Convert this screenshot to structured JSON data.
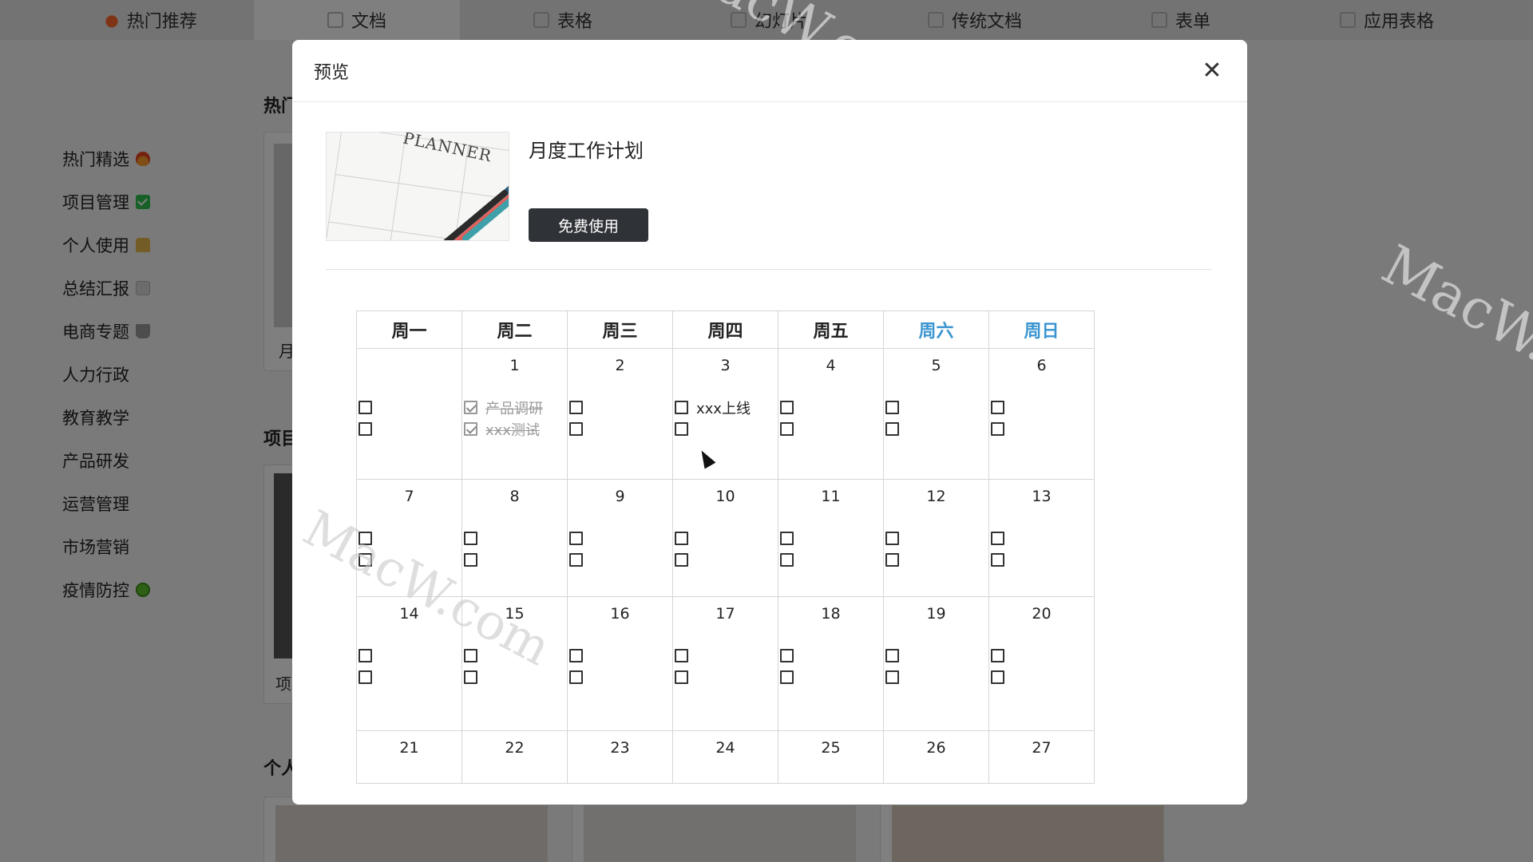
{
  "top_tabs": [
    {
      "label": "热门推荐",
      "icon": "fire-icon"
    },
    {
      "label": "文档",
      "icon": "doc-icon"
    },
    {
      "label": "表格",
      "icon": "sheet-icon"
    },
    {
      "label": "幻灯片",
      "icon": "slide-icon"
    },
    {
      "label": "传统文档",
      "icon": "word-icon"
    },
    {
      "label": "表单",
      "icon": "form-icon"
    },
    {
      "label": "应用表格",
      "icon": "app-sheet-icon"
    }
  ],
  "sidebar": {
    "items": [
      {
        "label": "热门精选",
        "icon": "fire-emoji"
      },
      {
        "label": "项目管理",
        "icon": "check-emoji"
      },
      {
        "label": "个人使用",
        "icon": "person-emoji"
      },
      {
        "label": "总结汇报",
        "icon": "doc-emoji"
      },
      {
        "label": "电商专题",
        "icon": "cart-emoji"
      },
      {
        "label": "人力行政",
        "icon": ""
      },
      {
        "label": "教育教学",
        "icon": ""
      },
      {
        "label": "产品研发",
        "icon": ""
      },
      {
        "label": "运营管理",
        "icon": ""
      },
      {
        "label": "市场营销",
        "icon": ""
      },
      {
        "label": "疫情防控",
        "icon": "virus-emoji"
      }
    ]
  },
  "background": {
    "heading_1": "热门",
    "heading_2": "项目",
    "heading_3": "个人",
    "card_1_label": "月",
    "card_2_label": "项"
  },
  "modal": {
    "title": "预览",
    "close_icon": "close-icon",
    "template_name": "月度工作计划",
    "thumbnail_text": "PLANNER",
    "use_button": "免费使用"
  },
  "calendar": {
    "weekdays": [
      "周一",
      "周二",
      "周三",
      "周四",
      "周五",
      "周六",
      "周日"
    ],
    "weekend_color": "#3a95d0",
    "weeks": [
      [
        "",
        "1",
        "2",
        "3",
        "4",
        "5",
        "6"
      ],
      [
        "7",
        "8",
        "9",
        "10",
        "11",
        "12",
        "13"
      ],
      [
        "14",
        "15",
        "16",
        "17",
        "18",
        "19",
        "20"
      ],
      [
        "21",
        "22",
        "23",
        "24",
        "25",
        "26",
        "27"
      ]
    ],
    "tasks": {
      "1": [
        {
          "label": "产品调研",
          "done": true
        },
        {
          "label": "xxx测试",
          "done": true
        }
      ],
      "3": [
        {
          "label": "xxx上线",
          "done": false
        },
        {
          "label": "",
          "done": false
        }
      ]
    }
  },
  "watermark": "MacW.com"
}
